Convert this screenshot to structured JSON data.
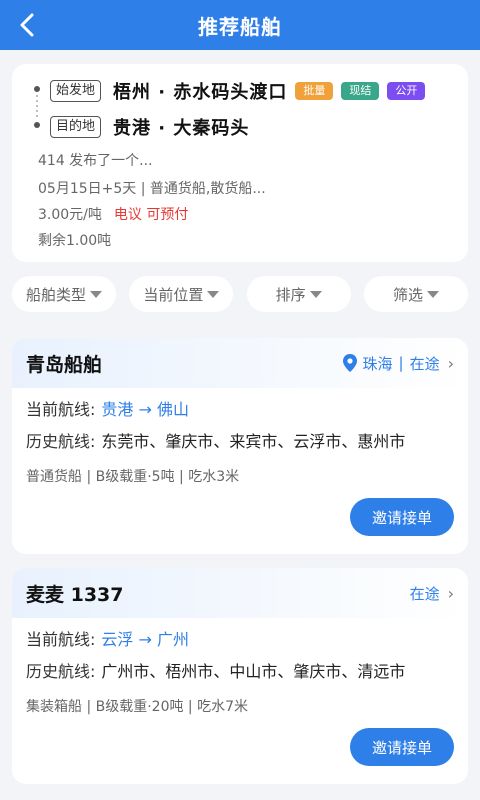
{
  "header": {
    "title": "推荐船舶"
  },
  "cargo": {
    "origin_tag": "始发地",
    "origin": "梧州 · 赤水码头渡口",
    "dest_tag": "目的地",
    "dest": "贵港 · 大秦码头",
    "badges": [
      {
        "label": "批量",
        "color": "#f0a13a"
      },
      {
        "label": "现结",
        "color": "#3aa68a"
      },
      {
        "label": "公开",
        "color": "#7c4df0"
      }
    ],
    "publisher": "414 发布了一个...",
    "date_info": "05月15日+5天 | 普通货船,散货船...",
    "price": "3.00元/吨",
    "price_note": "电议 可预付",
    "remaining": "剩余1.00吨"
  },
  "filters": [
    "船舶类型",
    "当前位置",
    "排序",
    "筛选"
  ],
  "ships": [
    {
      "name": "青岛船舶",
      "location": "珠海",
      "status": "在途",
      "current_label": "当前航线:",
      "current_route": "贵港 → 佛山",
      "history_label": "历史航线:",
      "history": "东莞市、肇庆市、来宾市、云浮市、惠州市",
      "spec": "普通货船 | B级载重·5吨 | 吃水3米",
      "invite_label": "邀请接单"
    },
    {
      "name": "麦麦 1337",
      "location": "",
      "status": "在途",
      "current_label": "当前航线:",
      "current_route": "云浮 → 广州",
      "history_label": "历史航线:",
      "history": "广州市、梧州市、中山市、肇庆市、清远市",
      "spec": "集装箱船 | B级载重·20吨 | 吃水7米",
      "invite_label": "邀请接单"
    }
  ]
}
